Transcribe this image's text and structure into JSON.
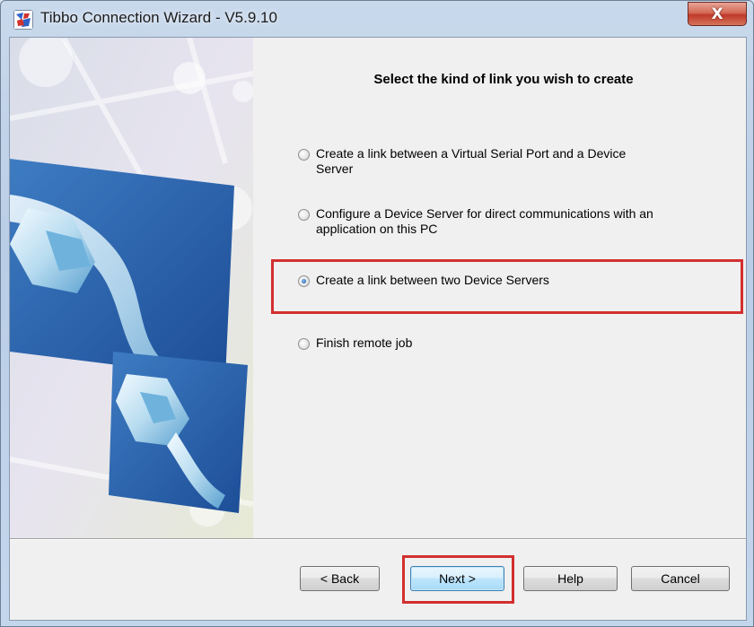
{
  "window": {
    "title": "Tibbo Connection Wizard - V5.9.10",
    "close_label": "X"
  },
  "page": {
    "heading": "Select the kind of link you wish to create"
  },
  "options": [
    {
      "label_line1": "Create a link between a Virtual Serial Port and a Device",
      "label_line2": "Server",
      "checked": false
    },
    {
      "label_line1": "Configure a Device Server for direct communications with an",
      "label_line2": "application on this PC",
      "checked": false
    },
    {
      "label_line1": "Create a link between two Device Servers",
      "label_line2": "",
      "checked": true
    },
    {
      "label_line1": "Finish remote job",
      "label_line2": "",
      "checked": false
    }
  ],
  "buttons": {
    "back": "< Back",
    "next": "Next >",
    "help": "Help",
    "cancel": "Cancel"
  },
  "colors": {
    "highlight": "#d32f2f",
    "accent_blue": "#2a5aa0"
  }
}
